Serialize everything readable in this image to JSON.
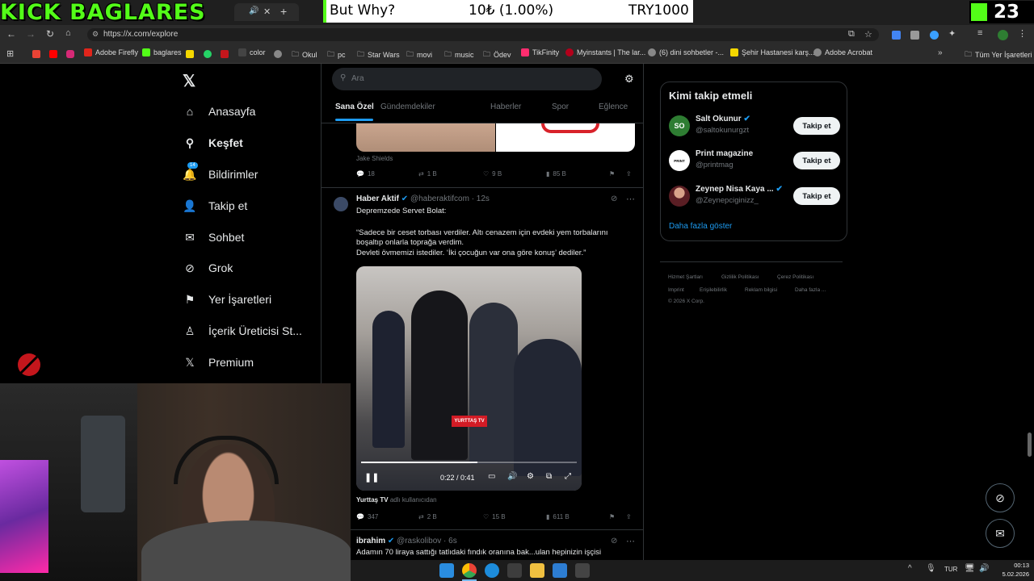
{
  "overlay": {
    "kick_logo": "KICK BAGLARES",
    "banner_name": "But Why?",
    "banner_amount": "10₺ (1.00%)",
    "banner_goal": "TRY1000",
    "viewer_count": "23"
  },
  "browser": {
    "url": "https://x.com/explore",
    "bookmarks": [
      "Adobe Firefly",
      "baglares",
      "color",
      "Okul",
      "pc",
      "Star Wars",
      "movi",
      "music",
      "Ödev",
      "TikFinity",
      "Myinstants | The lar...",
      "(6) dini sohbetler -...",
      "Şehir Hastanesi karş...",
      "Adobe Acrobat"
    ],
    "all_bookmarks": "Tüm Yer İşaretleri"
  },
  "nav": {
    "items": [
      "Anasayfa",
      "Keşfet",
      "Bildirimler",
      "Takip et",
      "Sohbet",
      "Grok",
      "Yer İşaretleri",
      "İçerik Üreticisi St...",
      "Premium"
    ],
    "notification_badge": "14"
  },
  "search": {
    "placeholder": "Ara"
  },
  "tabs": [
    "Sana Özel",
    "Gündemdekiler",
    "Haberler",
    "Spor",
    "Eğlence"
  ],
  "prev_post": {
    "caption": "Jake Shields",
    "replies": "18",
    "reposts": "1 B",
    "likes": "9 B",
    "views": "85 B"
  },
  "post": {
    "author": "Haber Aktif",
    "handle": "@haberaktifcom",
    "time": "· 12s",
    "line1": "Depremzede Servet Bolat:",
    "line2": "“Sadece bir ceset torbası verdiler. Altı cenazem için evdeki yem torbalarını",
    "line3": "boşaltıp onlarla toprağa verdim.",
    "line4": "Devleti övmemizi istediler. ‘İki çocuğun var ona göre konuş’ dediler.”",
    "video_time": "0:22 / 0:41",
    "video_progress": 0.54,
    "video_watermark": "YURTTAŞ TV",
    "source_name": "Yurttaş TV",
    "source_suffix": "adlı kullanıcıdan",
    "replies": "347",
    "reposts": "2 B",
    "likes": "15 B",
    "views": "611 B"
  },
  "next_post": {
    "author": "ibrahim",
    "handle": "@raskolibov",
    "time": "· 6s",
    "text": "Adamın 70 liraya sattığı tatlıdaki fındık oranına bak...ulan hepinizin işçisi"
  },
  "who_to_follow": {
    "title": "Kimi takip etmeli",
    "users": [
      {
        "name": "Salt Okunur",
        "handle": "@saltokunurgzt",
        "avatar_text": "SO",
        "button": "Takip et"
      },
      {
        "name": "Print magazine",
        "handle": "@printmag",
        "avatar_text": "PRINT",
        "button": "Takip et"
      },
      {
        "name": "Zeynep Nisa Kaya ...",
        "handle": "@Zeynepciginizz_",
        "avatar_text": "",
        "button": "Takip et"
      }
    ],
    "show_more": "Daha fazla göster"
  },
  "footer": {
    "row1": [
      "Hizmet Şartları",
      "Gizlilik Politikası",
      "Çerez Politikası"
    ],
    "row2": [
      "Imprint",
      "Erişilebilirlik",
      "Reklam bilgisi",
      "Daha fazla ..."
    ],
    "copyright": "© 2026 X Corp."
  },
  "taskbar": {
    "lang": "TUR",
    "time": "00:13",
    "date": "5.02.2026"
  },
  "colors": {
    "kick_green": "#53fc18",
    "x_blue": "#1d9bf0",
    "bg": "#000000"
  }
}
